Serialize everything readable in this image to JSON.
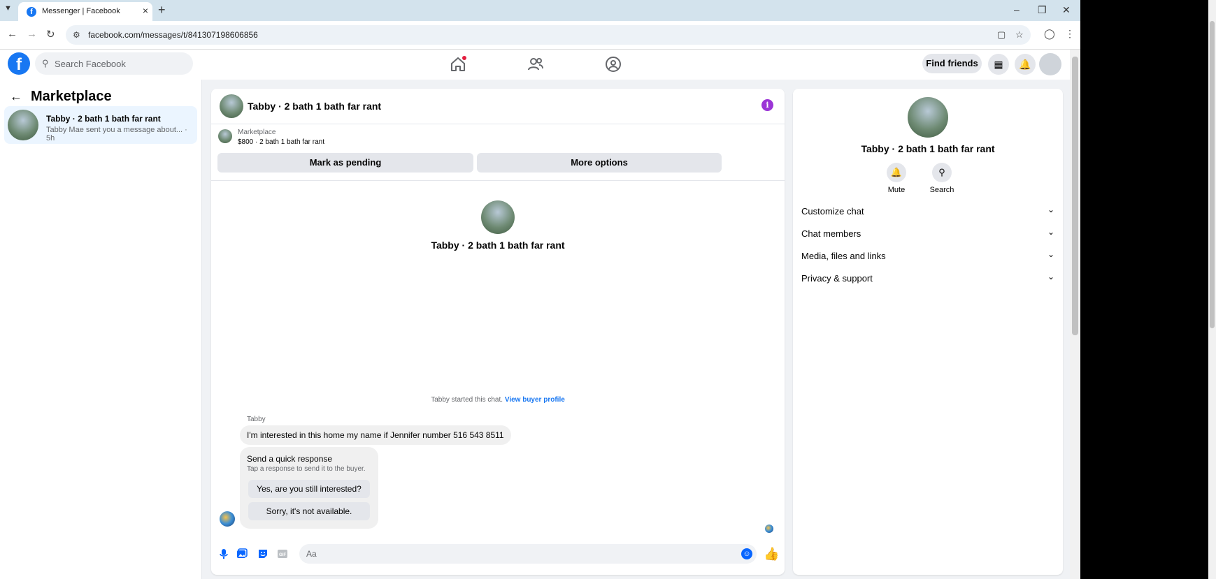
{
  "browser": {
    "tab_title": "Messenger | Facebook",
    "url": "facebook.com/messages/t/841307198606856"
  },
  "fb_header": {
    "search_placeholder": "Search Facebook",
    "find_friends": "Find friends"
  },
  "left_panel": {
    "title": "Marketplace",
    "conversations": [
      {
        "name": "Tabby · 2 bath 1 bath far rant",
        "preview": "Tabby Mae sent you a message about... · 5h"
      }
    ]
  },
  "chat": {
    "header_name": "Tabby · 2 bath 1 bath far rant",
    "listing": {
      "label": "Marketplace",
      "price_line": "$800 · 2 bath 1 bath far rant"
    },
    "actions": {
      "mark_pending": "Mark as pending",
      "more_options": "More options"
    },
    "center_name": "Tabby · 2 bath 1 bath far rant",
    "started_text": "Tabby started this chat.",
    "view_buyer_profile": "View buyer profile",
    "sender": "Tabby",
    "message": "I'm interested in this home my name if Jennifer number 516 543 8511",
    "quick_response": {
      "title": "Send a quick response",
      "subtitle": "Tap a response to send it to the buyer.",
      "options": [
        "Yes, are you still interested?",
        "Sorry, it's not available."
      ]
    },
    "composer_placeholder": "Aa"
  },
  "right_panel": {
    "name": "Tabby · 2 bath 1 bath far rant",
    "mute": "Mute",
    "search": "Search",
    "sections": [
      "Customize chat",
      "Chat members",
      "Media, files and links",
      "Privacy & support"
    ]
  },
  "colors": {
    "facebook_blue": "#1877f2",
    "messenger_blue": "#0866ff",
    "info_purple": "#9b34d6",
    "selected_row": "#ebf5ff"
  }
}
